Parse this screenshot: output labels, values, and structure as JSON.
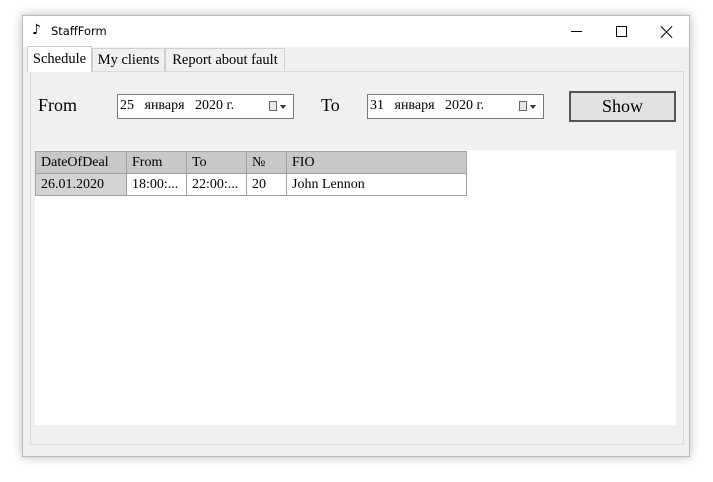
{
  "window": {
    "title": "StaffForm",
    "icon": "music-note-icon",
    "controls": {
      "minimize": "minimize-icon",
      "maximize": "maximize-icon",
      "close": "close-icon"
    }
  },
  "tabs": [
    {
      "label": "Schedule",
      "active": true
    },
    {
      "label": "My clients",
      "active": false
    },
    {
      "label": "Report about fault",
      "active": false
    }
  ],
  "filters": {
    "from_label": "From",
    "from_value": "25   января   2020 г.",
    "to_label": "To",
    "to_value": "31   января   2020 г.",
    "show_label": "Show"
  },
  "grid": {
    "columns": [
      "DateOfDeal",
      "From",
      "To",
      "№",
      "FIO"
    ],
    "rows": [
      [
        "26.01.2020",
        "18:00:...",
        "22:00:...",
        "20",
        "John Lennon"
      ]
    ]
  },
  "colors": {
    "header_bg": "#c8c8c8",
    "window_bg": "#f0f0f0"
  }
}
